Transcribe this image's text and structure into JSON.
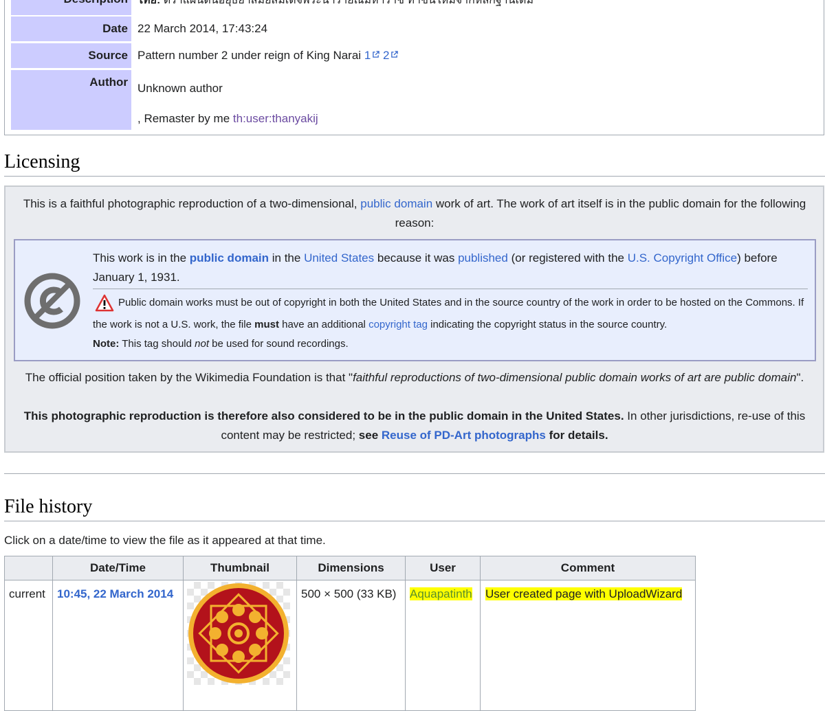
{
  "summary": {
    "description": {
      "label": "Description",
      "prefix": "ไทย:",
      "text": "ตราแผ่นดินอยุธยาสมัยสมเด็จพระนารายณ์มหาราช ทำขึ้นใหม่จากหลักฐานเดิม"
    },
    "date": {
      "label": "Date",
      "value": "22 March 2014, 17:43:24"
    },
    "source": {
      "label": "Source",
      "text": "Pattern number 2 under reign of King Narai",
      "link1": "1",
      "link2": "2"
    },
    "author": {
      "label": "Author",
      "line1": "Unknown author",
      "line2_prefix": ", Remaster by me",
      "line2_link": "th:user:thanyakij"
    }
  },
  "licensing": {
    "heading": "Licensing",
    "intro_part1": "This is a faithful photographic reproduction of a two-dimensional,",
    "intro_link": "public domain",
    "intro_part2": "work of art. The work of art itself is in the public domain for the following reason:",
    "pd": {
      "t1": "This work is in the",
      "l1": "public domain",
      "t2": "in the",
      "l2": "United States",
      "t3": "because it was",
      "l3": "published",
      "t4": "(or registered with the",
      "l4": "U.S. Copyright Office",
      "t5": ") before January 1, 1931.",
      "warn1": "Public domain works must be out of copyright in both the United States and in the source country of the work in order to be hosted on the Commons. If the work is not a U.S. work, the file",
      "warn_bold": "must",
      "warn2": "have an additional",
      "warn_link": "copyright tag",
      "warn3": "indicating the copyright status in the source country.",
      "note_label": "Note:",
      "note1": "This tag should",
      "note_em": "not",
      "note2": "be used for sound recordings."
    },
    "official1": "The official position taken by the Wikimedia Foundation is that \"",
    "official_em": "faithful reproductions of two-dimensional public domain works of art are public domain",
    "official2": "\".",
    "repro_bold": "This photographic reproduction is therefore also considered to be in the public domain in the United States.",
    "repro_text": "In other jurisdictions, re-use of this content may be restricted;",
    "see": "see",
    "see_link": "Reuse of PD-Art photographs",
    "see_tail": "for details."
  },
  "history": {
    "heading": "File history",
    "instruction": "Click on a date/time to view the file as it appeared at that time.",
    "columns": [
      "",
      "Date/Time",
      "Thumbnail",
      "Dimensions",
      "User",
      "Comment"
    ],
    "row": {
      "status": "current",
      "datetime": "10:45, 22 March 2014",
      "dimensions": "500 × 500 (33 KB)",
      "user": "Aquapatinth",
      "comment": "User created page with UploadWizard"
    }
  },
  "colors": {
    "link": "#3366cc",
    "visited": "#6b4ba1",
    "label_bg": "#ccccff",
    "highlight": "#ffff00",
    "emblem_red": "#b3121b",
    "emblem_gold": "#f3b12f"
  }
}
